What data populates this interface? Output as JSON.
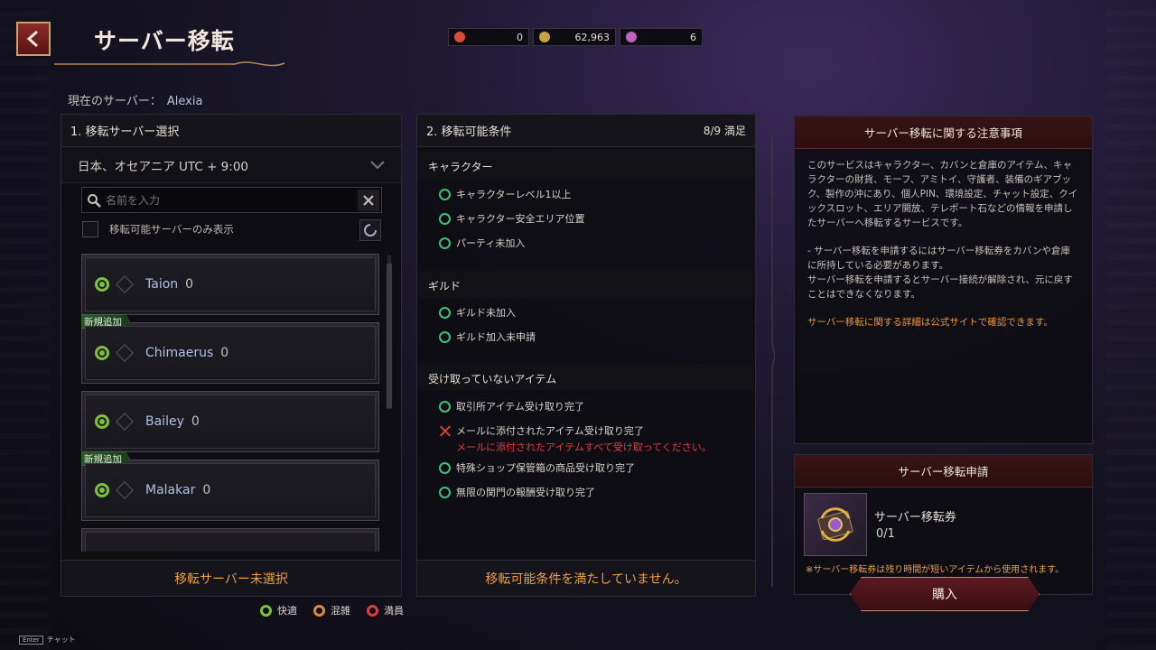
{
  "header": {
    "title": "サーバー移転",
    "back_icon": "back-arrow-icon"
  },
  "currency": [
    {
      "icon": "ticket-red-icon",
      "color": "#d84a3a",
      "value": "0"
    },
    {
      "icon": "gold-coin-icon",
      "color": "#c8a040",
      "value": "62,963"
    },
    {
      "icon": "purple-gem-icon",
      "color": "#c060c0",
      "value": "6"
    }
  ],
  "current_server": {
    "label": "現在のサーバー：",
    "value": "Alexia"
  },
  "panel1": {
    "title": "1. 移転サーバー選択",
    "timezone": "日本、オセアニア UTC + 9:00",
    "search_placeholder": "名前を入力",
    "filter_label": "移転可能サーバーのみ表示",
    "servers": [
      {
        "name": "Taion",
        "count": "0",
        "badge": ""
      },
      {
        "name": "Chimaerus",
        "count": "0",
        "badge": "新規追加"
      },
      {
        "name": "Bailey",
        "count": "0",
        "badge": ""
      },
      {
        "name": "Malakar",
        "count": "0",
        "badge": "新規追加"
      }
    ],
    "footer": "移転サーバー未選択"
  },
  "panel2": {
    "title": "2. 移転可能条件",
    "count": "8/9 満足",
    "sections": [
      {
        "title": "キャラクター",
        "items": [
          "キャラクターレベル1以上",
          "キャラクター安全エリア位置",
          "パーティ未加入"
        ]
      },
      {
        "title": "ギルド",
        "items": [
          "ギルド未加入",
          "ギルド加入未申請"
        ]
      },
      {
        "title": "受け取っていないアイテム",
        "items": [
          "取引所アイテム受け取り完了",
          "メールに添付されたアイテム受け取り完了",
          "特殊ショップ保管箱の商品受け取り完了",
          "無限の関門の報酬受け取り完了"
        ]
      }
    ],
    "fail_note": "メールに添付されたアイテムすべて受け取ってください。",
    "footer": "移転可能条件を満たしていません。"
  },
  "panel3": {
    "title": "サーバー移転に関する注意事項",
    "para1": "このサービスはキャラクター、カバンと倉庫のアイテム、キャラクターの財貨、モーフ、アミトイ、守護者、装備のギアブック、製作の沖にあり、個人PIN、環境設定、チャット設定、クイックスロット、エリア開放、テレポート石などの情報を申請したサーバーへ移転するサービスです。",
    "para2": "- サーバー移転を申請するにはサーバー移転券をカバンや倉庫に所持している必要があります。",
    "para3": "サーバー移転を申請するとサーバー接続が解除され、元に戻すことはできなくなります。",
    "para4": "サーバー移転に関する詳細は公式サイトで確認できます。"
  },
  "panel4": {
    "title": "サーバー移転申請",
    "ticket_name": "サーバー移転券",
    "ticket_count": "0/1",
    "note": "※サーバー移転券は残り時間が短いアイテムから使用されます。",
    "buy": "購入"
  },
  "legend": {
    "good": "快適",
    "busy": "混雑",
    "full": "満員"
  },
  "enter_hint": {
    "key": "Enter",
    "label": "チャット"
  },
  "colors": {
    "accent": "#e8a040",
    "ok": "#3dc07a",
    "error": "#d84040",
    "status_green": "#7ec03c"
  }
}
